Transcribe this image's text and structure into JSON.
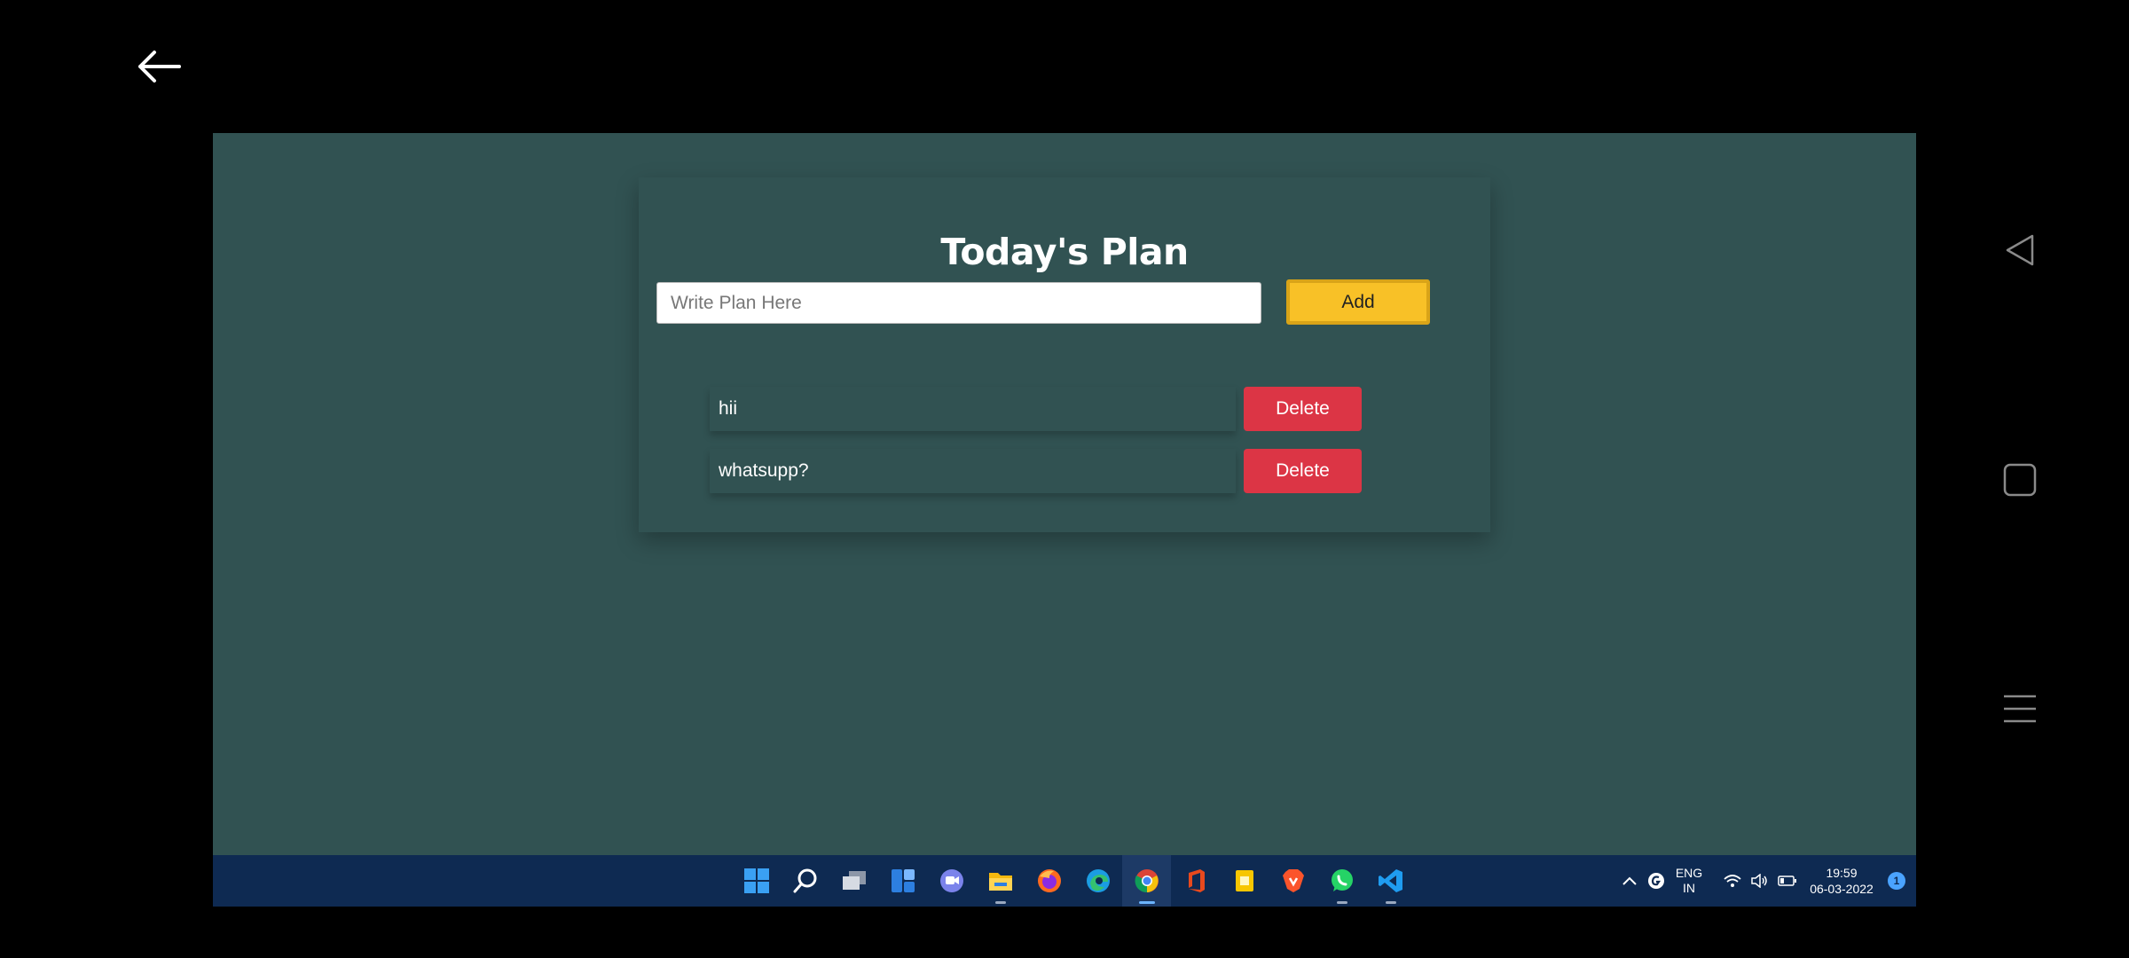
{
  "app": {
    "title": "Today's Plan",
    "input_placeholder": "Write Plan Here",
    "input_value": "",
    "add_label": "Add"
  },
  "plans": [
    {
      "text": "hii",
      "delete_label": "Delete"
    },
    {
      "text": "whatsupp?",
      "delete_label": "Delete"
    }
  ],
  "taskbar": {
    "apps": [
      "windows-start-icon",
      "search-icon",
      "task-view-icon",
      "widgets-icon",
      "teams-chat-icon",
      "file-explorer-icon",
      "firefox-icon",
      "edge-icon",
      "chrome-icon",
      "office-icon",
      "sticky-notes-icon",
      "brave-icon",
      "whatsapp-icon",
      "vscode-icon"
    ],
    "tray": {
      "lang_line1": "ENG",
      "lang_line2": "IN",
      "time": "19:59",
      "date": "06-03-2022",
      "notification_count": "1"
    }
  },
  "colors": {
    "background": "#315252",
    "add_button": "#f8c127",
    "delete_button": "#dc3545",
    "taskbar": "#0e2a52"
  }
}
